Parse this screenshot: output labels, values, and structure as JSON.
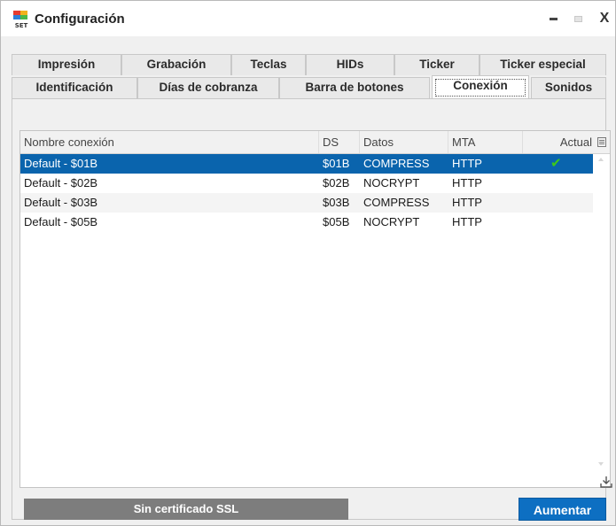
{
  "window": {
    "title": "Configuración",
    "logo_text": "SET",
    "min_icon": "minimize-icon",
    "max_icon": "maximize-icon",
    "close_label": "X"
  },
  "tabs_row1": [
    {
      "label": "Impresión",
      "mnemonic": ""
    },
    {
      "label": "Grabación",
      "mnemonic": "G"
    },
    {
      "label": "Teclas",
      "mnemonic": "T"
    },
    {
      "label": "HIDs",
      "mnemonic": ""
    },
    {
      "label": "Ticker",
      "mnemonic": "k"
    },
    {
      "label": "Ticker especial",
      "mnemonic": "e"
    }
  ],
  "tabs_row2": [
    {
      "label": "Identificación",
      "mnemonic": "I"
    },
    {
      "label": "Días de cobranza",
      "mnemonic": "n"
    },
    {
      "label": "Barra de botones",
      "mnemonic": "B"
    },
    {
      "label": "Conexión",
      "mnemonic": "x",
      "active": true
    },
    {
      "label": "Sonidos",
      "mnemonic": "o"
    }
  ],
  "grid": {
    "columns": [
      "Nombre conexión",
      "DS",
      "Datos",
      "MTA",
      "Actual"
    ],
    "rows": [
      {
        "nombre": "Default - $01B",
        "ds": "$01B",
        "datos": "COMPRESS",
        "mta": "HTTP",
        "actual": "✔",
        "selected": true
      },
      {
        "nombre": "Default - $02B",
        "ds": "$02B",
        "datos": "NOCRYPT",
        "mta": "HTTP",
        "actual": ""
      },
      {
        "nombre": "Default - $03B",
        "ds": "$03B",
        "datos": "COMPRESS",
        "mta": "HTTP",
        "actual": ""
      },
      {
        "nombre": "Default - $05B",
        "ds": "$05B",
        "datos": "NOCRYPT",
        "mta": "HTTP",
        "actual": ""
      }
    ]
  },
  "footer": {
    "ssl_status": "Sin certificado SSL",
    "aumentar_label": "Aumentar"
  },
  "colors": {
    "selection": "#0a64ad",
    "primary_button": "#0d6fc2",
    "status_bar": "#7d7d7d",
    "check": "#3dc71c"
  }
}
